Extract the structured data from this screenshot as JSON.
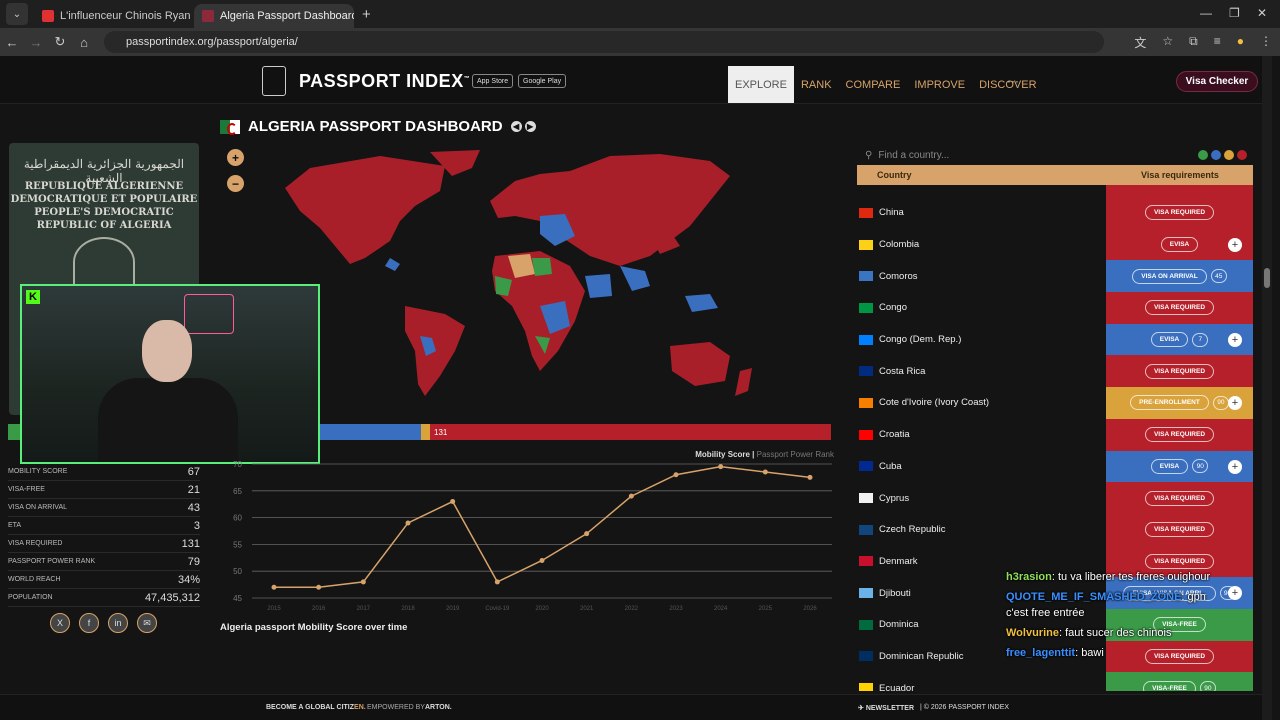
{
  "browser": {
    "tabs": [
      {
        "title": "L'influenceur Chinois Ryan Che",
        "favicon_color": "#e03030"
      },
      {
        "title": "Algeria Passport Dashboard | Pa",
        "favicon_color": "#8a2a3a"
      }
    ],
    "url": "passportindex.org/passport/algeria/"
  },
  "site": {
    "logo": "PASSPORT INDEX",
    "logo_tm": "™",
    "app_store": "App Store",
    "google_play": "Google Play",
    "nav": [
      "EXPLORE",
      "RANK",
      "COMPARE",
      "IMPROVE",
      "DISCOVER"
    ],
    "nav_more": "···",
    "visa_checker": "Visa Checker"
  },
  "dashboard": {
    "title_country": "ALGERIA",
    "title_rest": "PASSPORT DASHBOARD",
    "passport_text": {
      "arabic": "الجمهورية الجزائرية الديمقراطية الشعبية",
      "line1": "REPUBLIQUE ALGERIENNE",
      "line2": "DEMOCRATIQUE ET POPULAIRE",
      "line3": "PEOPLE'S DEMOCRATIC",
      "line4": "REPUBLIC OF ALGERIA"
    },
    "zoom_in": "+",
    "zoom_out": "−",
    "powerbar_value": "131",
    "stats": [
      {
        "label": "MOBILITY SCORE",
        "value": "67"
      },
      {
        "label": "VISA-FREE",
        "value": "21"
      },
      {
        "label": "VISA ON ARRIVAL",
        "value": "43"
      },
      {
        "label": "ETA",
        "value": "3"
      },
      {
        "label": "VISA REQUIRED",
        "value": "131"
      },
      {
        "label": "PASSPORT POWER RANK",
        "value": "79"
      },
      {
        "label": "WORLD REACH",
        "value": "34%"
      },
      {
        "label": "POPULATION",
        "value": "47,435,312"
      }
    ],
    "social": [
      "X",
      "f",
      "in",
      "✉"
    ],
    "chart_legend_main": "Mobility Score",
    "chart_legend_sep": " | ",
    "chart_legend_alt": "Passport Power Rank",
    "chart_caption": "Algeria passport Mobility Score over time"
  },
  "chart_data": {
    "type": "line",
    "x": [
      "2015",
      "2016",
      "2017",
      "2018",
      "2019",
      "Covid-19",
      "2020",
      "2021",
      "2022",
      "2023",
      "2024",
      "2025",
      "2026"
    ],
    "series": [
      {
        "name": "Mobility Score",
        "values": [
          47,
          47,
          48,
          59,
          63,
          48,
          52,
          57,
          64,
          68,
          69.5,
          68.5,
          67.5
        ]
      }
    ],
    "ylim": [
      45,
      70
    ],
    "yticks": [
      45,
      50,
      55,
      60,
      65,
      70
    ],
    "grid": true,
    "color": "#d7a36a"
  },
  "table": {
    "search_placeholder": "Find a country...",
    "col_country": "Country",
    "col_visa": "Visa requirements",
    "rows": [
      {
        "name": "China",
        "flag": "#de2910",
        "req": "VISA REQUIRED",
        "color": "#b5202a"
      },
      {
        "name": "Colombia",
        "flag": "#fcd116",
        "req": "EVISA",
        "color": "#b5202a",
        "plus": true
      },
      {
        "name": "Comoros",
        "flag": "#3a75c4",
        "req": "VISA ON ARRIVAL",
        "days": "45",
        "color": "#3a6fbf"
      },
      {
        "name": "Congo",
        "flag": "#009543",
        "req": "VISA REQUIRED",
        "color": "#b5202a"
      },
      {
        "name": "Congo (Dem. Rep.)",
        "flag": "#007fff",
        "req": "EVISA",
        "days": "7",
        "color": "#3a6fbf",
        "plus": true
      },
      {
        "name": "Costa Rica",
        "flag": "#002b7f",
        "req": "VISA REQUIRED",
        "color": "#b5202a"
      },
      {
        "name": "Cote d'Ivoire (Ivory Coast)",
        "flag": "#f77f00",
        "req": "PRE-ENROLLMENT",
        "days": "90",
        "color": "#d9a23a",
        "plus": true
      },
      {
        "name": "Croatia",
        "flag": "#ff0000",
        "req": "VISA REQUIRED",
        "color": "#b5202a"
      },
      {
        "name": "Cuba",
        "flag": "#002a8f",
        "req": "EVISA",
        "days": "90",
        "color": "#3a6fbf",
        "plus": true
      },
      {
        "name": "Cyprus",
        "flag": "#f0f0f0",
        "req": "VISA REQUIRED",
        "color": "#b5202a"
      },
      {
        "name": "Czech Republic",
        "flag": "#11457e",
        "req": "VISA REQUIRED",
        "color": "#b5202a"
      },
      {
        "name": "Denmark",
        "flag": "#c8102e",
        "req": "VISA REQUIRED",
        "color": "#b5202a"
      },
      {
        "name": "Djibouti",
        "flag": "#6ab2e7",
        "req": "EVISA / VISA ON ARRI...",
        "days": "90",
        "color": "#3a6fbf",
        "plus": true
      },
      {
        "name": "Dominica",
        "flag": "#006b3f",
        "req": "VISA-FREE",
        "color": "#3a9a48"
      },
      {
        "name": "Dominican Republic",
        "flag": "#002d62",
        "req": "VISA REQUIRED",
        "color": "#b5202a"
      },
      {
        "name": "Ecuador",
        "flag": "#ffd100",
        "req": "VISA-FREE",
        "days": "90",
        "color": "#3a9a48"
      }
    ]
  },
  "chat": [
    {
      "user": "h3rasion",
      "user_color": "#8fe05a",
      "text": ": tu va liberer tes freres ouighour"
    },
    {
      "user": "QUOTE_ME_IF_SMASHED_ZONE",
      "user_color": "#3a8fff",
      "text": ": gpn c'est free entrée"
    },
    {
      "user": "Wolvurine",
      "user_color": "#f0c040",
      "text": ": faut sucer des chinois"
    },
    {
      "user": "free_lagenttit",
      "user_color": "#3a8fff",
      "text": ": bawi"
    }
  ],
  "footer": {
    "left1": "BECOME A GLOBAL CITIZ",
    "left1_accent": "EN.",
    "left2": "EMPOWERED BY",
    "left3": "ARTON.",
    "newsletter": "NEWSLETTER",
    "copyright": "| © 2026 PASSPORT INDEX"
  }
}
